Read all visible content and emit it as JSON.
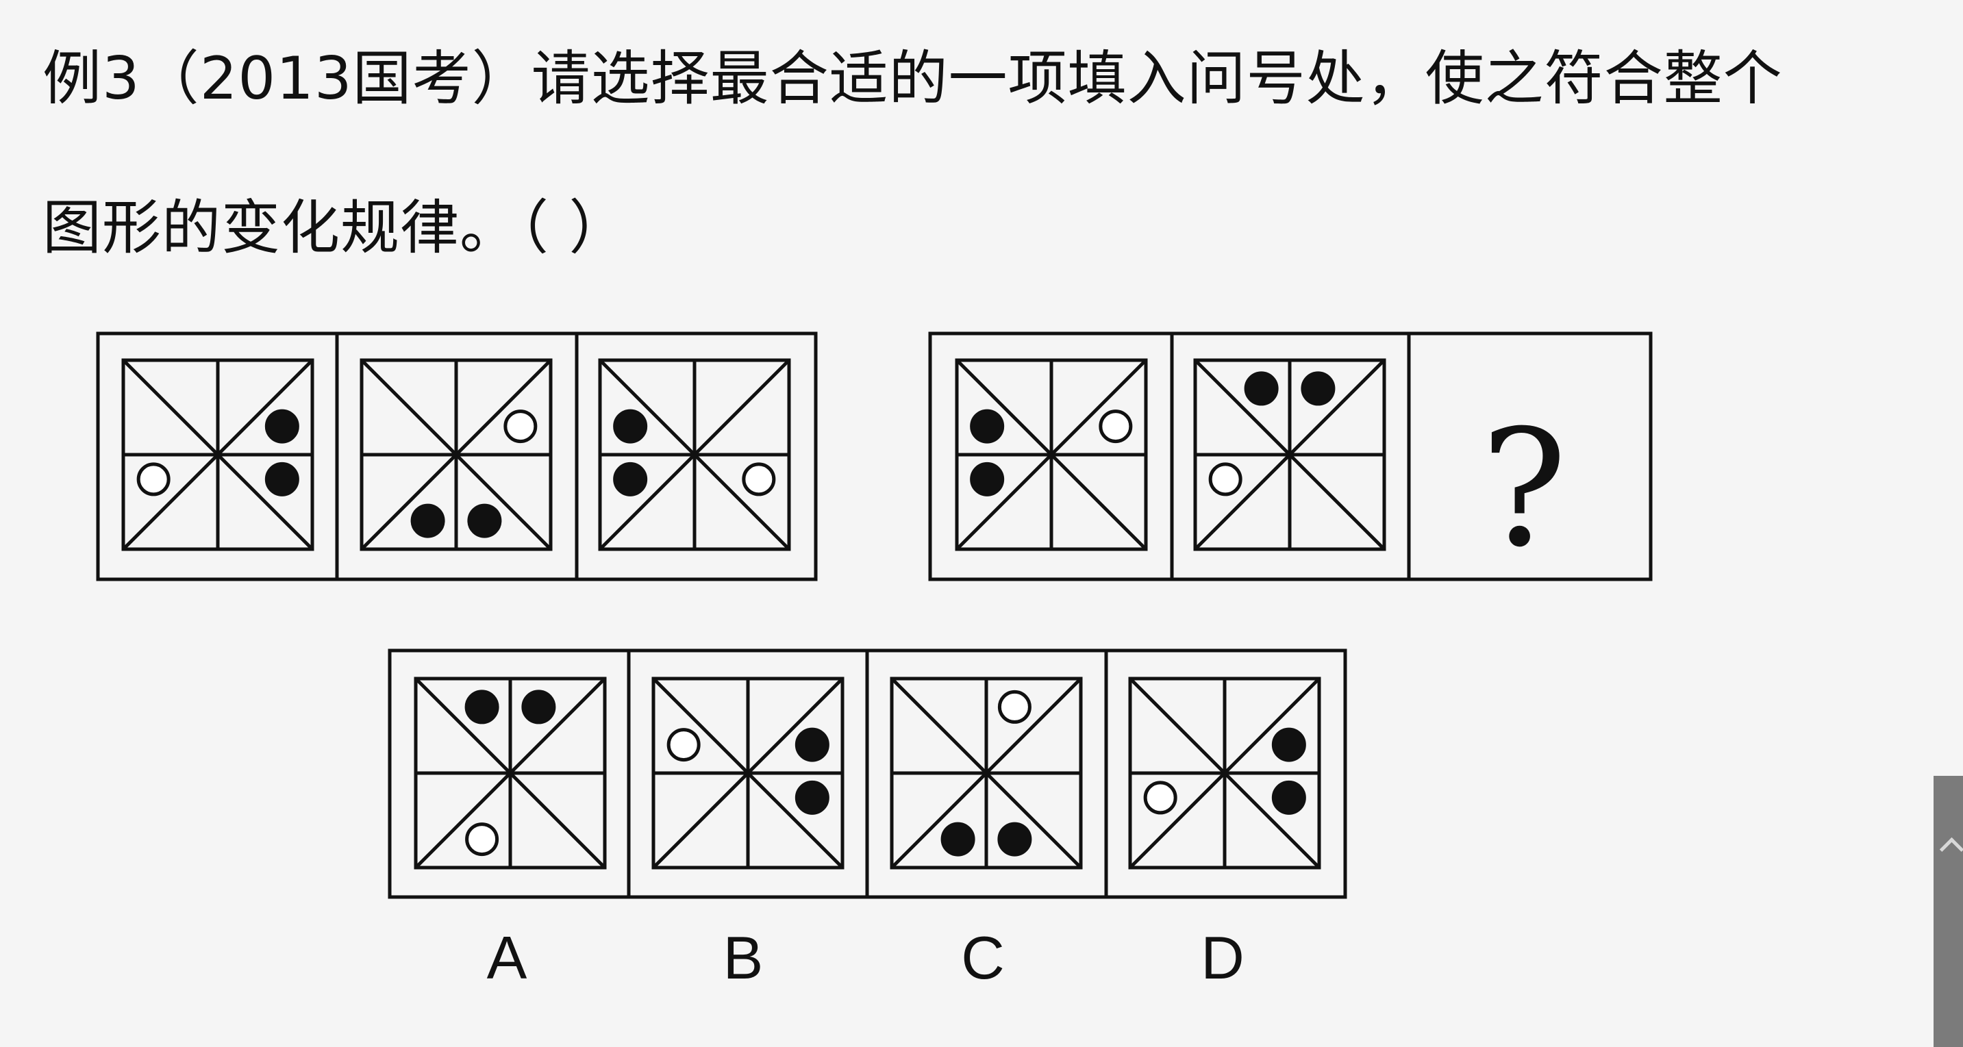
{
  "question": {
    "line1": "例3（2013国考）请选择最合适的一项填入问号处，使之符合整个",
    "line2": "图形的变化规律。（ ）"
  },
  "unknown_mark": "?",
  "options": [
    "A",
    "B",
    "C",
    "D"
  ],
  "colors": {
    "stroke": "#111111",
    "background": "#f5f5f5",
    "tab": "#7b7b7b"
  },
  "figures": {
    "group1": [
      {
        "filled": [
          "r1",
          "r2"
        ],
        "hollow": [
          "l2"
        ]
      },
      {
        "filled": [
          "b1",
          "b2"
        ],
        "hollow": [
          "r1"
        ]
      },
      {
        "filled": [
          "l1",
          "l2"
        ],
        "hollow": [
          "r2"
        ]
      }
    ],
    "group2": [
      {
        "filled": [
          "l1",
          "l2"
        ],
        "hollow": [
          "r1"
        ]
      },
      {
        "filled": [
          "t1",
          "t2"
        ],
        "hollow": [
          "l2"
        ]
      }
    ],
    "answers": [
      {
        "filled": [
          "t1",
          "t2"
        ],
        "hollow": [
          "b1"
        ]
      },
      {
        "filled": [
          "r1",
          "r2"
        ],
        "hollow": [
          "l1"
        ]
      },
      {
        "filled": [
          "b1",
          "b2"
        ],
        "hollow": [
          "t2"
        ]
      },
      {
        "filled": [
          "r1",
          "r2"
        ],
        "hollow": [
          "l2"
        ]
      }
    ]
  }
}
